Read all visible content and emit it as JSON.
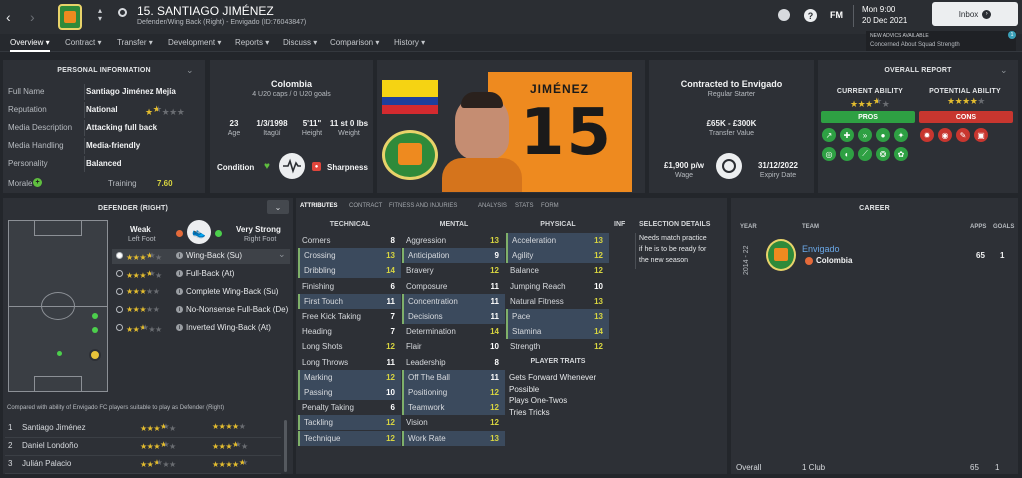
{
  "header": {
    "player_name": "15. SANTIAGO JIMÉNEZ",
    "subtitle": "Defender/Wing Back (Right) - Envigado (ID:76043847)",
    "fm_label": "FM",
    "date_line1": "Mon 9:00",
    "date_line2": "20 Dec 2021",
    "inbox_label": "Inbox",
    "advice_line1": "NEW ADVICS AVAILABLE",
    "advice_line2": "Concerned About Squad Strength",
    "advice_badge": "1"
  },
  "nav": [
    "Overview",
    "Contract",
    "Transfer",
    "Development",
    "Reports",
    "Discuss",
    "Comparison",
    "History"
  ],
  "personal": {
    "title": "PERSONAL INFORMATION",
    "rows": [
      {
        "label": "Full Name",
        "value": "Santiago Jiménez Mejía"
      },
      {
        "label": "Reputation",
        "value": "National"
      },
      {
        "label": "Media Description",
        "value": "Attacking full back"
      },
      {
        "label": "Media Handling",
        "value": "Media-friendly"
      },
      {
        "label": "Personality",
        "value": "Balanced"
      }
    ],
    "reputation_stars": 1.5,
    "morale_label": "Morale",
    "training_label": "Training",
    "training_value": "7.60"
  },
  "bio": {
    "nation": "Colombia",
    "caps": "4 U20 caps / 0 U20 goals",
    "age": "23",
    "age_label": "Age",
    "dob": "1/3/1998",
    "birthplace": "Itagüí",
    "height": "5'11\"",
    "height_label": "Height",
    "weight": "11 st 0 lbs",
    "weight_label": "Weight",
    "condition_label": "Condition",
    "sharpness_label": "Sharpness"
  },
  "portrait": {
    "shirt_name": "JIMÉNEZ",
    "shirt_number": "15"
  },
  "contract": {
    "title": "Contracted to Envigado",
    "status": "Regular Starter",
    "value": "£65K - £300K",
    "value_label": "Transfer Value",
    "wage": "£1,900 p/w",
    "wage_label": "Wage",
    "expiry": "31/12/2022",
    "expiry_label": "Expiry Date"
  },
  "report": {
    "title": "OVERALL REPORT",
    "ca_label": "CURRENT ABILITY",
    "pa_label": "POTENTIAL ABILITY",
    "ca_stars": 3.5,
    "pa_stars": 4,
    "pros_label": "PROS",
    "cons_label": "CONS"
  },
  "position": {
    "title": "DEFENDER (RIGHT)",
    "weak_label": "Weak",
    "weak_sub": "Left Foot",
    "strong_label": "Very Strong",
    "strong_sub": "Right Foot",
    "roles": [
      {
        "name": "Wing-Back (Su)",
        "stars": 3.5
      },
      {
        "name": "Full-Back (At)",
        "stars": 3.5
      },
      {
        "name": "Complete Wing-Back (Su)",
        "stars": 3
      },
      {
        "name": "No-Nonsense Full-Back (De)",
        "stars": 3
      },
      {
        "name": "Inverted Wing-Back (At)",
        "stars": 2.5
      }
    ],
    "compare_text": "Compared with ability of Envigado FC players suitable to play as Defender (Right)",
    "compare": [
      {
        "rank": "1",
        "name": "Santiago Jiménez",
        "ca": 3.5,
        "pa": 4
      },
      {
        "rank": "2",
        "name": "Daniel Londoño",
        "ca": 3.5,
        "pa": 3.5
      },
      {
        "rank": "3",
        "name": "Julián Palacio",
        "ca": 2.5,
        "pa": 4.5
      }
    ]
  },
  "tabs": [
    "ATTRIBUTES",
    "CONTRACT",
    "FITNESS AND INJURIES",
    "ANALYSIS",
    "STATS",
    "FORM"
  ],
  "attributes": {
    "technical_label": "TECHNICAL",
    "mental_label": "MENTAL",
    "physical_label": "PHYSICAL",
    "technical": [
      {
        "name": "Corners",
        "value": "8",
        "hl": false
      },
      {
        "name": "Crossing",
        "value": "13",
        "hl": true
      },
      {
        "name": "Dribbling",
        "value": "14",
        "hl": true
      },
      {
        "name": "Finishing",
        "value": "6",
        "hl": false
      },
      {
        "name": "First Touch",
        "value": "11",
        "hl": true
      },
      {
        "name": "Free Kick Taking",
        "value": "7",
        "hl": false
      },
      {
        "name": "Heading",
        "value": "7",
        "hl": false
      },
      {
        "name": "Long Shots",
        "value": "12",
        "hl": false
      },
      {
        "name": "Long Throws",
        "value": "11",
        "hl": false
      },
      {
        "name": "Marking",
        "value": "12",
        "hl": true
      },
      {
        "name": "Passing",
        "value": "10",
        "hl": true
      },
      {
        "name": "Penalty Taking",
        "value": "6",
        "hl": false
      },
      {
        "name": "Tackling",
        "value": "12",
        "hl": true
      },
      {
        "name": "Technique",
        "value": "12",
        "hl": true
      }
    ],
    "mental": [
      {
        "name": "Aggression",
        "value": "13",
        "hl": false
      },
      {
        "name": "Anticipation",
        "value": "9",
        "hl": true
      },
      {
        "name": "Bravery",
        "value": "12",
        "hl": false
      },
      {
        "name": "Composure",
        "value": "11",
        "hl": false
      },
      {
        "name": "Concentration",
        "value": "11",
        "hl": true
      },
      {
        "name": "Decisions",
        "value": "11",
        "hl": true
      },
      {
        "name": "Determination",
        "value": "14",
        "hl": false
      },
      {
        "name": "Flair",
        "value": "10",
        "hl": false
      },
      {
        "name": "Leadership",
        "value": "8",
        "hl": false
      },
      {
        "name": "Off The Ball",
        "value": "11",
        "hl": true
      },
      {
        "name": "Positioning",
        "value": "12",
        "hl": true
      },
      {
        "name": "Teamwork",
        "value": "12",
        "hl": true
      },
      {
        "name": "Vision",
        "value": "12",
        "hl": false
      },
      {
        "name": "Work Rate",
        "value": "13",
        "hl": true
      }
    ],
    "physical": [
      {
        "name": "Acceleration",
        "value": "13",
        "hl": true
      },
      {
        "name": "Agility",
        "value": "12",
        "hl": true
      },
      {
        "name": "Balance",
        "value": "12",
        "hl": false
      },
      {
        "name": "Jumping Reach",
        "value": "10",
        "hl": false
      },
      {
        "name": "Natural Fitness",
        "value": "13",
        "hl": false
      },
      {
        "name": "Pace",
        "value": "13",
        "hl": true
      },
      {
        "name": "Stamina",
        "value": "14",
        "hl": true
      },
      {
        "name": "Strength",
        "value": "12",
        "hl": false
      }
    ],
    "traits_label": "PLAYER TRAITS",
    "traits": [
      "Gets Forward Whenever",
      "Possible",
      "Plays One-Twos",
      "Tries Tricks"
    ],
    "inf_label": "INF",
    "selection_label": "SELECTION DETAILS",
    "selection_text": [
      "Needs match practice",
      "if he is to be ready for",
      "the new season"
    ]
  },
  "career": {
    "title": "CAREER",
    "year_label": "YEAR",
    "team_label": "TEAM",
    "apps_label": "APPS",
    "goals_label": "GOALS",
    "season": "2014 - 22",
    "club": "Envigado",
    "country": "Colombia",
    "apps": "65",
    "goals": "1",
    "overall_label": "Overall",
    "overall_clubs": "1 Club",
    "overall_apps": "65",
    "overall_goals": "1"
  },
  "colors": {
    "accent": "#5fbf3f",
    "star": "#e4bd2f",
    "club_green": "#2f8a3a",
    "club_orange": "#ee8a1f",
    "pros": "#2ea043",
    "cons": "#c8362f"
  }
}
